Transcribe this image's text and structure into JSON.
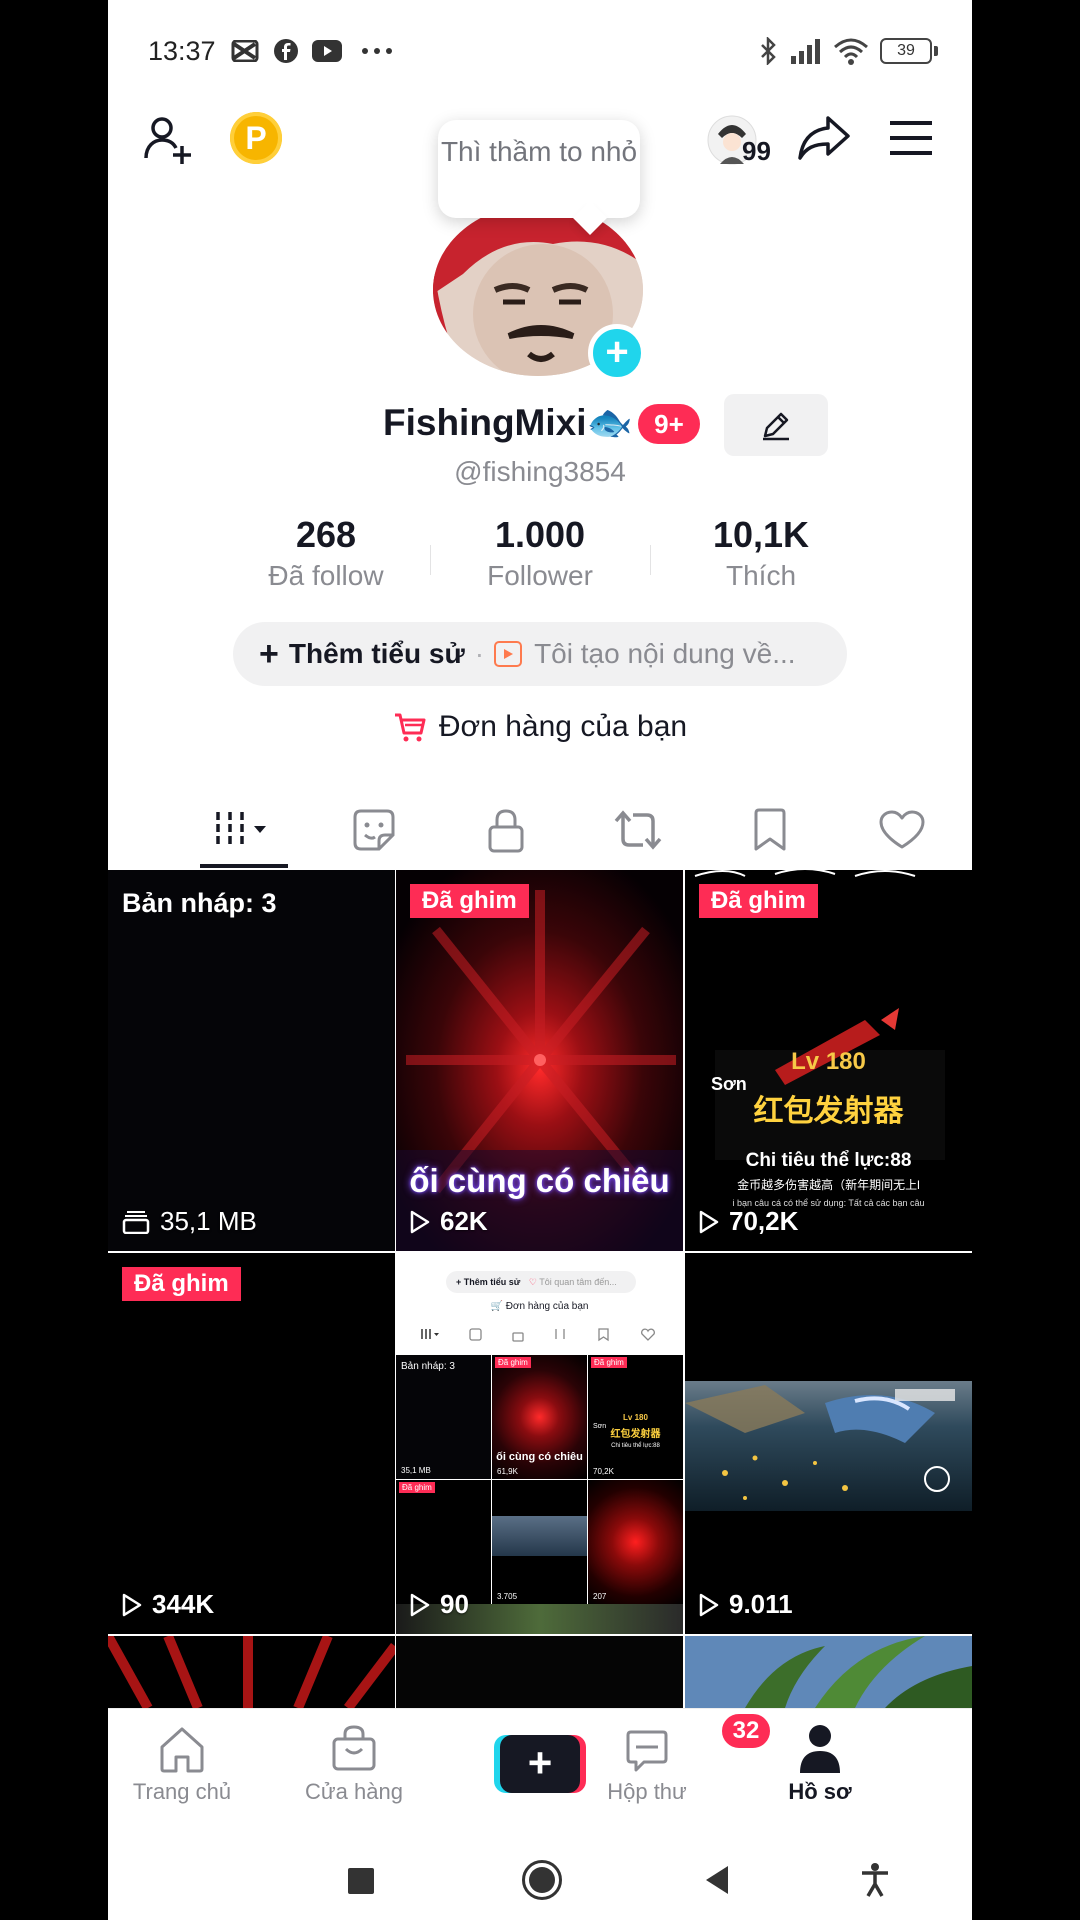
{
  "status_bar": {
    "time": "13:37",
    "battery": "39",
    "icons": [
      "capcut-icon",
      "facebook-icon",
      "youtube-icon",
      "more-dots-icon",
      "bluetooth-icon",
      "signal-icon",
      "wifi-icon",
      "battery-icon"
    ]
  },
  "header": {
    "visitors_count": "99",
    "icons": [
      "add-friend-icon",
      "points-icon",
      "visitor-avatar-icon",
      "share-icon",
      "menu-icon"
    ]
  },
  "profile": {
    "bubble_text": "Thì thầm to nhỏ",
    "name": "FishingMixi🐟",
    "notif_count": "9+",
    "handle": "@fishing3854",
    "stats": [
      {
        "value": "268",
        "label": "Đã follow"
      },
      {
        "value": "1.000",
        "label": "Follower"
      },
      {
        "value": "10,1K",
        "label": "Thích"
      }
    ],
    "add_bio_label": "Thêm tiểu sử",
    "bio_separator": "·",
    "bio_placeholder": "Tôi tạo nội dung về...",
    "orders_label": "Đơn hàng của bạn"
  },
  "tabs": [
    "videos-grid-icon",
    "sticker-icon",
    "lock-icon",
    "repost-icon",
    "bookmark-icon",
    "heart-icon"
  ],
  "grid": {
    "pinned_label": "Đã ghim",
    "draft_label": "Bản nháp: 3",
    "draft_size": "35,1 MB",
    "videos": [
      {
        "views": "62K",
        "caption": "ối cùng có chiêu"
      },
      {
        "views": "70,2K",
        "level": "Lv 180",
        "title_cn": "红包发射器",
        "line1": "Chi tiêu thể lực:88",
        "line2": "金币越多伤害越高（新年期间无上l",
        "line3": "i bạn câu cá có thể sử dụng: Tất cả các bạn câu",
        "side": "Sơn"
      },
      {
        "views": "344K"
      },
      {
        "views": "90"
      },
      {
        "views": "9.011"
      }
    ],
    "mini": {
      "bio": "Thêm tiểu sử",
      "bio_hint": "Tôi quan tâm đến...",
      "orders": "Đơn hàng của bạn",
      "draft": "Bản nháp: 3",
      "size": "35,1 MB",
      "pinned": "Đã ghim",
      "caption": "ối cùng có chiêu",
      "v1": "61,9K",
      "v2": "70,2K",
      "level": "Lv 180",
      "title_cn": "红包发射器",
      "line1": "Chi tiêu thể lực:88",
      "side": "Sơn",
      "v3": "3.705",
      "v4": "207"
    }
  },
  "bottom_nav": {
    "home": "Trang chủ",
    "shop": "Cửa hàng",
    "inbox": "Hộp thư",
    "inbox_badge": "32",
    "profile": "Hồ sơ"
  },
  "colors": {
    "accent": "#fe2c55",
    "cyan": "#20d5ec",
    "gold": "#f7b500",
    "text": "#161823",
    "secondary": "#8a8b91"
  }
}
